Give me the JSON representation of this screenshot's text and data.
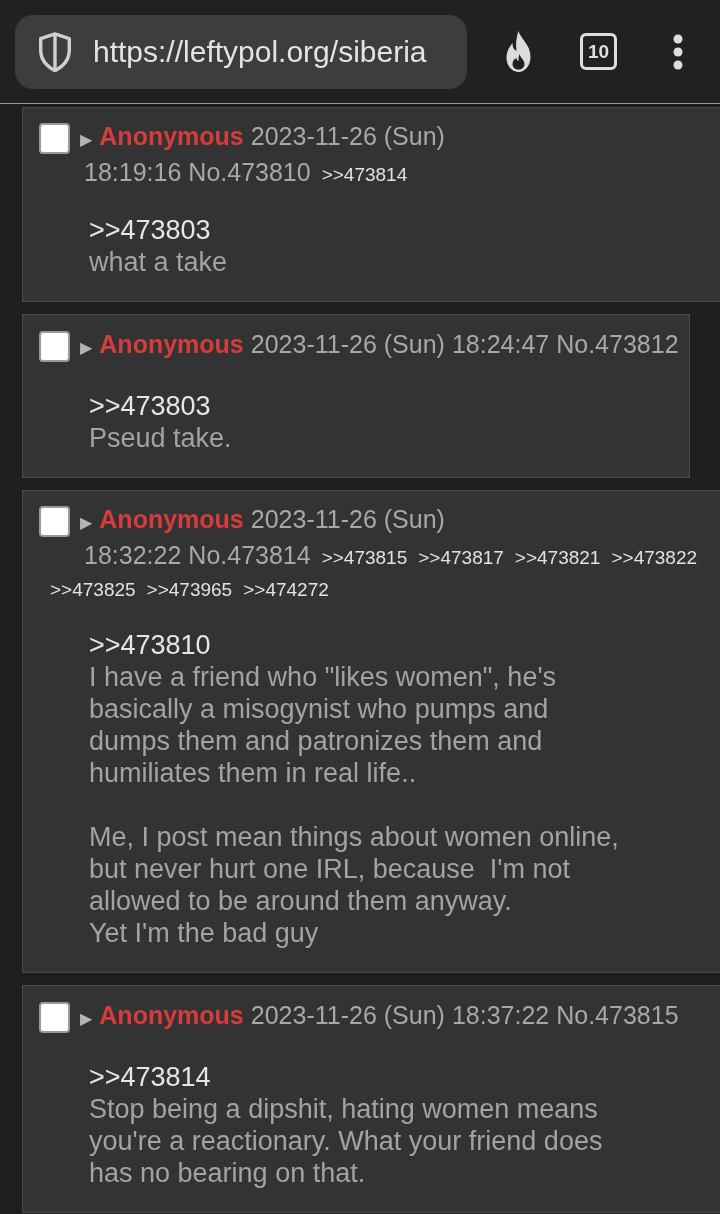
{
  "browser": {
    "url": "https://leftypol.org/siberia",
    "tab_count": "10"
  },
  "posts": [
    {
      "checked": false,
      "toggle": "▶",
      "name": "Anonymous",
      "date": "2023-11-26 (Sun)",
      "time": "18:19:16",
      "number": "No.473810",
      "backlinks": [
        ">>473814"
      ],
      "body": [
        {
          "kind": "quote_link",
          "text": ">>473803"
        },
        {
          "kind": "paragraph",
          "lines": [
            "what a take"
          ]
        }
      ]
    },
    {
      "checked": false,
      "toggle": "▶",
      "name": "Anonymous",
      "date": "2023-11-26 (Sun)",
      "time": "18:24:47",
      "number": "No.473812",
      "body": [
        {
          "kind": "quote_link",
          "text": ">>473803"
        },
        {
          "kind": "paragraph",
          "lines": [
            "Pseud take."
          ]
        }
      ]
    },
    {
      "checked": false,
      "toggle": "▶",
      "name": "Anonymous",
      "date": "2023-11-26 (Sun)",
      "time": "18:32:22",
      "number": "No.473814",
      "backlinks": [
        ">>473815",
        ">>473817",
        ">>473821",
        ">>473822",
        ">>473825",
        ">>473965",
        ">>474272"
      ],
      "body": [
        {
          "kind": "quote_link",
          "text": ">>473810"
        },
        {
          "kind": "paragraph",
          "lines": [
            "I have a friend who \"likes women\", he's",
            "basically a misogynist who pumps and",
            "dumps them and patronizes them and",
            "humiliates them in real life.."
          ]
        },
        {
          "kind": "paragraph",
          "lines": [
            "Me, I post mean things about women online,",
            "but never hurt one IRL, because  I'm not",
            "allowed to be around them anyway.",
            "Yet I'm the bad guy"
          ]
        }
      ]
    },
    {
      "checked": false,
      "toggle": "▶",
      "name": "Anonymous",
      "date": "2023-11-26 (Sun)",
      "time": "18:37:22",
      "number": "No.473815",
      "body": [
        {
          "kind": "quote_link",
          "text": ">>473814"
        },
        {
          "kind": "paragraph",
          "lines": [
            "Stop being a dipshit, hating women means",
            "you're a reactionary. What your friend does",
            "has no bearing on that."
          ]
        }
      ]
    }
  ]
}
